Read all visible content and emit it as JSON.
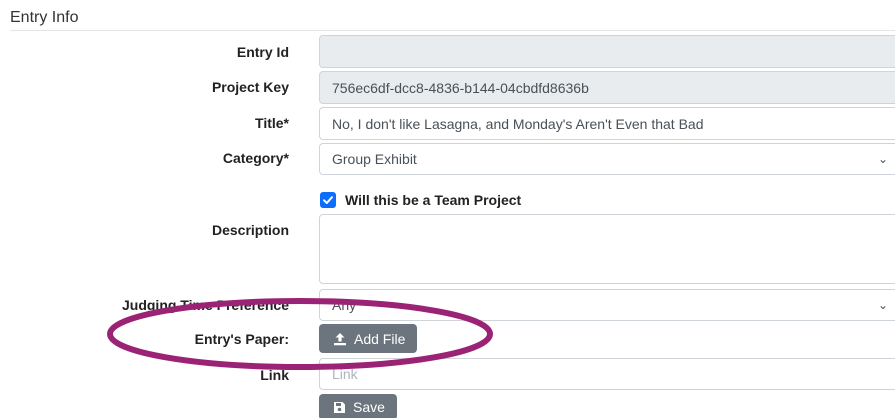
{
  "section": {
    "title": "Entry Info"
  },
  "form": {
    "entry_id": {
      "label": "Entry Id",
      "value": ""
    },
    "project_key": {
      "label": "Project Key",
      "value": "756ec6df-dcc8-4836-b144-04cbdfd8636b"
    },
    "title": {
      "label": "Title*",
      "value": "No, I don't like Lasagna, and Monday's Aren't Even that Bad"
    },
    "category": {
      "label": "Category*",
      "selected": "Group Exhibit"
    },
    "team_project": {
      "label": "Will this be a Team Project",
      "checked": true
    },
    "description": {
      "label": "Description",
      "value": ""
    },
    "judging_time": {
      "label": "Judging Time Preference",
      "selected": "Any"
    },
    "entry_paper": {
      "label": "Entry's Paper:",
      "button_label": "Add File"
    },
    "link": {
      "label": "Link",
      "placeholder": "Link"
    },
    "save": {
      "button_label": "Save"
    }
  },
  "annotation": {
    "color": "#9b2376"
  },
  "colors": {
    "readonly_bg": "#e9ecef",
    "button_bg": "#6c757d",
    "checkbox_accent": "#0d6efd"
  }
}
